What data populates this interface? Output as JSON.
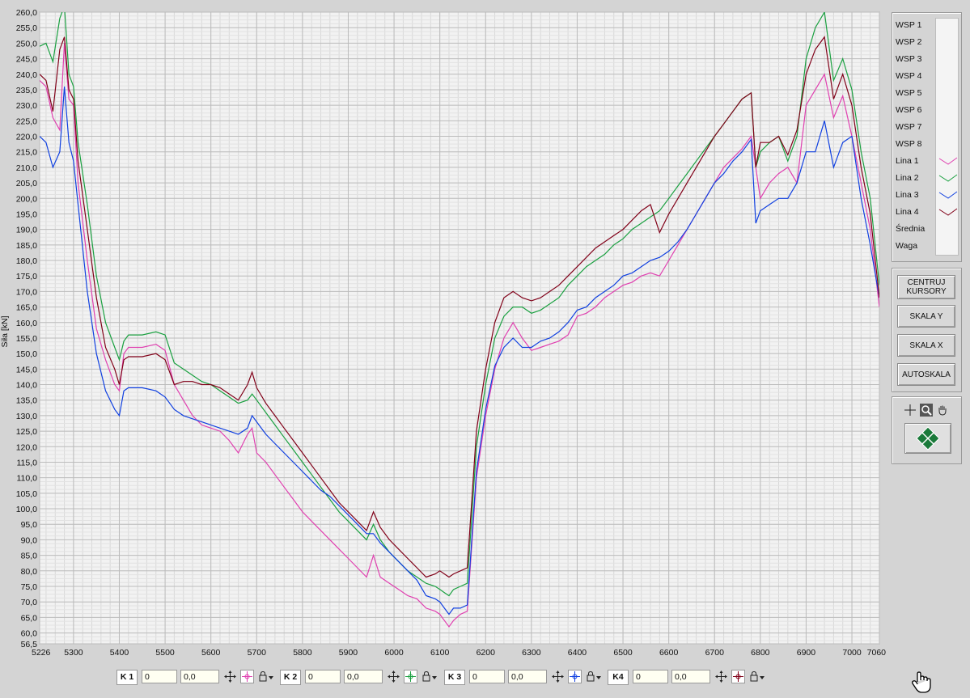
{
  "chart_data": {
    "type": "line",
    "ylabel": "Siła [kN]",
    "xlim": [
      5226,
      7060
    ],
    "ylim": [
      56.5,
      260
    ],
    "yticks": [
      56.5,
      60,
      65,
      70,
      75,
      80,
      85,
      90,
      95,
      100,
      105,
      110,
      115,
      120,
      125,
      130,
      135,
      140,
      145,
      150,
      155,
      160,
      165,
      170,
      175,
      180,
      185,
      190,
      195,
      200,
      205,
      210,
      215,
      220,
      225,
      230,
      235,
      240,
      245,
      250,
      255,
      260
    ],
    "ytick_labels": [
      "56,5",
      "60,0",
      "65,0",
      "70,0",
      "75,0",
      "80,0",
      "85,0",
      "90,0",
      "95,0",
      "100,0",
      "105,0",
      "110,0",
      "115,0",
      "120,0",
      "125,0",
      "130,0",
      "135,0",
      "140,0",
      "145,0",
      "150,0",
      "155,0",
      "160,0",
      "165,0",
      "170,0",
      "175,0",
      "180,0",
      "185,0",
      "190,0",
      "195,0",
      "200,0",
      "205,0",
      "210,0",
      "215,0",
      "220,0",
      "225,0",
      "230,0",
      "235,0",
      "240,0",
      "245,0",
      "250,0",
      "255,0",
      "260,0"
    ],
    "xticks": [
      5226,
      5300,
      5400,
      5500,
      5600,
      5700,
      5800,
      5900,
      6000,
      6100,
      6200,
      6300,
      6400,
      6500,
      6600,
      6700,
      6800,
      6900,
      7000,
      7060
    ],
    "xtick_labels": [
      "5226",
      "5300",
      "5400",
      "5500",
      "5600",
      "5700",
      "5800",
      "5900",
      "6000",
      "6100",
      "6200",
      "6300",
      "6400",
      "6500",
      "6600",
      "6700",
      "6800",
      "6900",
      "7000",
      "7060"
    ],
    "grid": true,
    "series": [
      {
        "name": "Lina 1",
        "color": "#e040b0",
        "x": [
          5226,
          5240,
          5255,
          5270,
          5280,
          5290,
          5300,
          5310,
          5330,
          5350,
          5370,
          5390,
          5400,
          5410,
          5420,
          5450,
          5480,
          5500,
          5520,
          5540,
          5560,
          5580,
          5600,
          5620,
          5640,
          5660,
          5680,
          5690,
          5700,
          5720,
          5740,
          5760,
          5780,
          5800,
          5820,
          5840,
          5860,
          5880,
          5900,
          5920,
          5940,
          5955,
          5970,
          5990,
          6010,
          6030,
          6050,
          6070,
          6090,
          6100,
          6110,
          6120,
          6130,
          6145,
          6160,
          6180,
          6200,
          6220,
          6240,
          6260,
          6280,
          6300,
          6320,
          6340,
          6360,
          6380,
          6400,
          6420,
          6440,
          6460,
          6480,
          6500,
          6520,
          6540,
          6560,
          6580,
          6600,
          6620,
          6640,
          6660,
          6680,
          6700,
          6720,
          6740,
          6760,
          6780,
          6790,
          6800,
          6820,
          6840,
          6860,
          6880,
          6900,
          6920,
          6940,
          6960,
          6980,
          7000,
          7020,
          7040,
          7060
        ],
        "y": [
          238,
          236,
          226,
          222,
          250,
          232,
          230,
          205,
          180,
          158,
          148,
          140,
          138,
          150,
          152,
          152,
          153,
          151,
          140,
          135,
          130,
          127,
          126,
          125,
          122,
          118,
          124,
          126,
          118,
          115,
          111,
          107,
          103,
          99,
          96,
          93,
          90,
          87,
          84,
          81,
          78,
          85,
          78,
          76,
          74,
          72,
          71,
          68,
          67,
          66,
          64,
          62,
          64,
          66,
          67,
          110,
          130,
          145,
          155,
          160,
          155,
          151,
          152,
          153,
          154,
          156,
          162,
          163,
          165,
          168,
          170,
          172,
          173,
          175,
          176,
          175,
          180,
          185,
          190,
          195,
          200,
          205,
          210,
          213,
          216,
          220,
          210,
          200,
          205,
          208,
          210,
          205,
          230,
          235,
          240,
          226,
          233,
          220,
          205,
          190,
          165
        ]
      },
      {
        "name": "Lina 2",
        "color": "#1aa040",
        "x": [
          5226,
          5240,
          5255,
          5270,
          5280,
          5290,
          5300,
          5310,
          5330,
          5350,
          5370,
          5390,
          5400,
          5410,
          5420,
          5450,
          5480,
          5500,
          5520,
          5540,
          5560,
          5580,
          5600,
          5620,
          5640,
          5660,
          5680,
          5690,
          5700,
          5720,
          5740,
          5760,
          5780,
          5800,
          5820,
          5840,
          5860,
          5880,
          5900,
          5920,
          5940,
          5955,
          5970,
          5990,
          6010,
          6030,
          6050,
          6070,
          6090,
          6100,
          6110,
          6120,
          6130,
          6145,
          6160,
          6180,
          6200,
          6220,
          6240,
          6260,
          6280,
          6300,
          6320,
          6340,
          6360,
          6380,
          6400,
          6420,
          6440,
          6460,
          6480,
          6500,
          6520,
          6540,
          6560,
          6580,
          6600,
          6620,
          6640,
          6660,
          6680,
          6700,
          6720,
          6740,
          6760,
          6780,
          6790,
          6800,
          6820,
          6840,
          6860,
          6880,
          6900,
          6920,
          6940,
          6960,
          6980,
          7000,
          7020,
          7040,
          7060
        ],
        "y": [
          249,
          250,
          244,
          258,
          262,
          240,
          236,
          218,
          198,
          175,
          160,
          152,
          148,
          154,
          156,
          156,
          157,
          156,
          147,
          145,
          143,
          141,
          140,
          138,
          136,
          134,
          135,
          137,
          135,
          131,
          127,
          123,
          119,
          115,
          111,
          107,
          103,
          99,
          96,
          93,
          90,
          95,
          90,
          86,
          83,
          80,
          78,
          76,
          75,
          74,
          73,
          72,
          74,
          75,
          76,
          120,
          140,
          155,
          162,
          165,
          165,
          163,
          164,
          166,
          168,
          172,
          175,
          178,
          180,
          182,
          185,
          187,
          190,
          192,
          194,
          196,
          200,
          204,
          208,
          212,
          216,
          220,
          224,
          228,
          232,
          234,
          210,
          215,
          218,
          220,
          212,
          220,
          245,
          255,
          260,
          238,
          245,
          235,
          215,
          200,
          172
        ]
      },
      {
        "name": "Lina 3",
        "color": "#1040e0",
        "x": [
          5226,
          5240,
          5255,
          5270,
          5280,
          5290,
          5300,
          5310,
          5330,
          5350,
          5370,
          5390,
          5400,
          5410,
          5420,
          5450,
          5480,
          5500,
          5520,
          5540,
          5560,
          5580,
          5600,
          5620,
          5640,
          5660,
          5680,
          5690,
          5700,
          5720,
          5740,
          5760,
          5780,
          5800,
          5820,
          5840,
          5860,
          5880,
          5900,
          5920,
          5940,
          5955,
          5970,
          5990,
          6010,
          6030,
          6050,
          6070,
          6090,
          6100,
          6110,
          6120,
          6130,
          6145,
          6160,
          6180,
          6200,
          6220,
          6240,
          6260,
          6280,
          6300,
          6320,
          6340,
          6360,
          6380,
          6400,
          6420,
          6440,
          6460,
          6480,
          6500,
          6520,
          6540,
          6560,
          6580,
          6600,
          6620,
          6640,
          6660,
          6680,
          6700,
          6720,
          6740,
          6760,
          6780,
          6790,
          6800,
          6820,
          6840,
          6860,
          6880,
          6900,
          6920,
          6940,
          6960,
          6980,
          7000,
          7020,
          7040,
          7060
        ],
        "y": [
          220,
          218,
          210,
          215,
          236,
          218,
          212,
          198,
          170,
          150,
          138,
          132,
          130,
          138,
          139,
          139,
          138,
          136,
          132,
          130,
          129,
          128,
          127,
          126,
          125,
          124,
          126,
          130,
          128,
          124,
          121,
          118,
          115,
          112,
          109,
          106,
          104,
          101,
          98,
          95,
          92,
          92,
          89,
          86,
          83,
          80,
          77,
          72,
          71,
          70,
          68,
          66,
          68,
          68,
          69,
          112,
          132,
          146,
          152,
          155,
          152,
          152,
          154,
          155,
          157,
          160,
          164,
          165,
          168,
          170,
          172,
          175,
          176,
          178,
          180,
          181,
          183,
          186,
          190,
          195,
          200,
          205,
          208,
          212,
          215,
          219,
          192,
          196,
          198,
          200,
          200,
          205,
          215,
          215,
          225,
          210,
          218,
          220,
          200,
          185,
          168
        ]
      },
      {
        "name": "Lina 4",
        "color": "#800018",
        "x": [
          5226,
          5240,
          5255,
          5270,
          5280,
          5290,
          5300,
          5310,
          5330,
          5350,
          5370,
          5390,
          5400,
          5410,
          5420,
          5450,
          5480,
          5500,
          5520,
          5540,
          5560,
          5580,
          5600,
          5620,
          5640,
          5660,
          5680,
          5690,
          5700,
          5720,
          5740,
          5760,
          5780,
          5800,
          5820,
          5840,
          5860,
          5880,
          5900,
          5920,
          5940,
          5955,
          5970,
          5990,
          6010,
          6030,
          6050,
          6070,
          6090,
          6100,
          6110,
          6120,
          6130,
          6145,
          6160,
          6180,
          6200,
          6220,
          6240,
          6260,
          6280,
          6300,
          6320,
          6340,
          6360,
          6380,
          6400,
          6420,
          6440,
          6460,
          6480,
          6500,
          6520,
          6540,
          6560,
          6580,
          6600,
          6620,
          6640,
          6660,
          6680,
          6700,
          6720,
          6740,
          6760,
          6780,
          6790,
          6800,
          6820,
          6840,
          6860,
          6880,
          6900,
          6920,
          6940,
          6960,
          6980,
          7000,
          7020,
          7040,
          7060
        ],
        "y": [
          240,
          238,
          228,
          248,
          252,
          235,
          232,
          212,
          190,
          168,
          152,
          145,
          140,
          148,
          149,
          149,
          150,
          148,
          140,
          141,
          141,
          140,
          140,
          139,
          137,
          135,
          140,
          144,
          139,
          134,
          130,
          126,
          122,
          118,
          114,
          110,
          106,
          102,
          99,
          96,
          93,
          99,
          94,
          90,
          87,
          84,
          81,
          78,
          79,
          80,
          79,
          78,
          79,
          80,
          81,
          125,
          145,
          160,
          168,
          170,
          168,
          167,
          168,
          170,
          172,
          175,
          178,
          181,
          184,
          186,
          188,
          190,
          193,
          196,
          198,
          189,
          195,
          200,
          205,
          210,
          215,
          220,
          224,
          228,
          232,
          234,
          210,
          218,
          218,
          220,
          214,
          222,
          240,
          248,
          252,
          232,
          240,
          230,
          210,
          195,
          168
        ]
      }
    ]
  },
  "legend": {
    "items": [
      {
        "label": "WSP 1",
        "color": ""
      },
      {
        "label": "WSP 2",
        "color": ""
      },
      {
        "label": "WSP 3",
        "color": ""
      },
      {
        "label": "WSP 4",
        "color": ""
      },
      {
        "label": "WSP 5",
        "color": ""
      },
      {
        "label": "WSP 6",
        "color": ""
      },
      {
        "label": "WSP 7",
        "color": ""
      },
      {
        "label": "WSP 8",
        "color": ""
      },
      {
        "label": "Lina 1",
        "color": "#e040b0"
      },
      {
        "label": "Lina 2",
        "color": "#1aa040"
      },
      {
        "label": "Lina 3",
        "color": "#1040e0"
      },
      {
        "label": "Lina 4",
        "color": "#800018"
      },
      {
        "label": "Średnia",
        "color": ""
      },
      {
        "label": "Waga",
        "color": ""
      }
    ]
  },
  "buttons": {
    "center_cursors": "CENTRUJ KURSORY",
    "scale_y": "SKALA Y",
    "scale_x": "SKALA X",
    "autoscale": "AUTOSKALA"
  },
  "cursors": [
    {
      "label": "K 1",
      "index": "0",
      "value": "0,0",
      "color": "#e040b0"
    },
    {
      "label": "K 2",
      "index": "0",
      "value": "0,0",
      "color": "#1aa040"
    },
    {
      "label": "K 3",
      "index": "0",
      "value": "0,0",
      "color": "#1040e0"
    },
    {
      "label": "K4",
      "index": "0",
      "value": "0,0",
      "color": "#800018"
    }
  ]
}
